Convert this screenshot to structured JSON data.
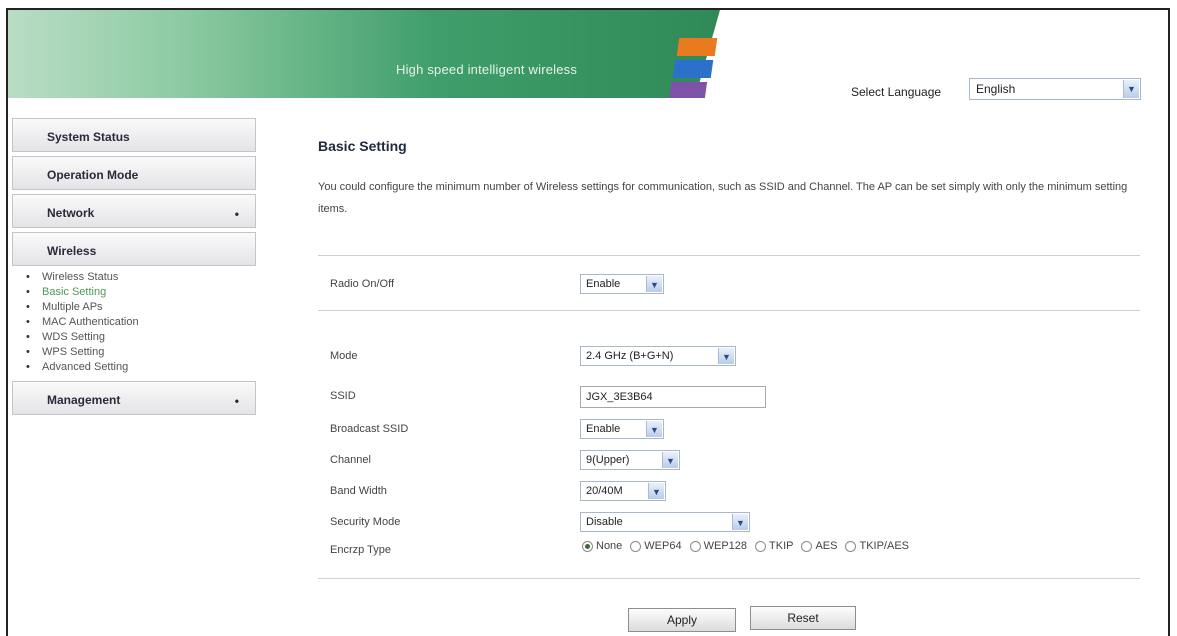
{
  "header": {
    "tagline": "High speed intelligent wireless",
    "language_label": "Select Language",
    "language_value": "English"
  },
  "sidebar": {
    "items": [
      {
        "label": "System Status",
        "has_submenu": false
      },
      {
        "label": "Operation Mode",
        "has_submenu": false
      },
      {
        "label": "Network",
        "has_submenu": true,
        "bullet": "•"
      },
      {
        "label": "Wireless",
        "has_submenu": false
      },
      {
        "label": "Management",
        "has_submenu": true,
        "bullet": "•"
      }
    ],
    "wireless_submenu": [
      {
        "label": "Wireless Status",
        "active": false
      },
      {
        "label": "Basic Setting",
        "active": true
      },
      {
        "label": "Multiple APs",
        "active": false
      },
      {
        "label": "MAC Authentication",
        "active": false
      },
      {
        "label": "WDS Setting",
        "active": false
      },
      {
        "label": "WPS Setting",
        "active": false
      },
      {
        "label": "Advanced Setting",
        "active": false
      }
    ],
    "active_color": "#4c9b57"
  },
  "main": {
    "title": "Basic Setting",
    "description": "You could configure the minimum number of Wireless settings for communication, such as SSID and Channel. The AP can be set simply with only the minimum setting items.",
    "radio_onoff": {
      "label": "Radio On/Off",
      "value": "Enable"
    },
    "fields": {
      "mode": {
        "label": "Mode",
        "value": "2.4 GHz (B+G+N)"
      },
      "ssid": {
        "label": "SSID",
        "value": "JGX_3E3B64"
      },
      "broadcast_ssid": {
        "label": "Broadcast SSID",
        "value": "Enable"
      },
      "channel": {
        "label": "Channel",
        "value": "9(Upper)"
      },
      "band_width": {
        "label": "Band Width",
        "value": "20/40M"
      },
      "security_mode": {
        "label": "Security Mode",
        "value": "Disable"
      },
      "encrypt_type": {
        "label": "Encrzp Type",
        "options": [
          "None",
          "WEP64",
          "WEP128",
          "TKIP",
          "AES",
          "TKIP/AES"
        ],
        "selected": "None"
      }
    },
    "buttons": {
      "apply": "Apply",
      "reset": "Reset"
    }
  },
  "icons": {
    "dropdown": "chevron-down-icon",
    "bullet": "bullet-icon"
  }
}
